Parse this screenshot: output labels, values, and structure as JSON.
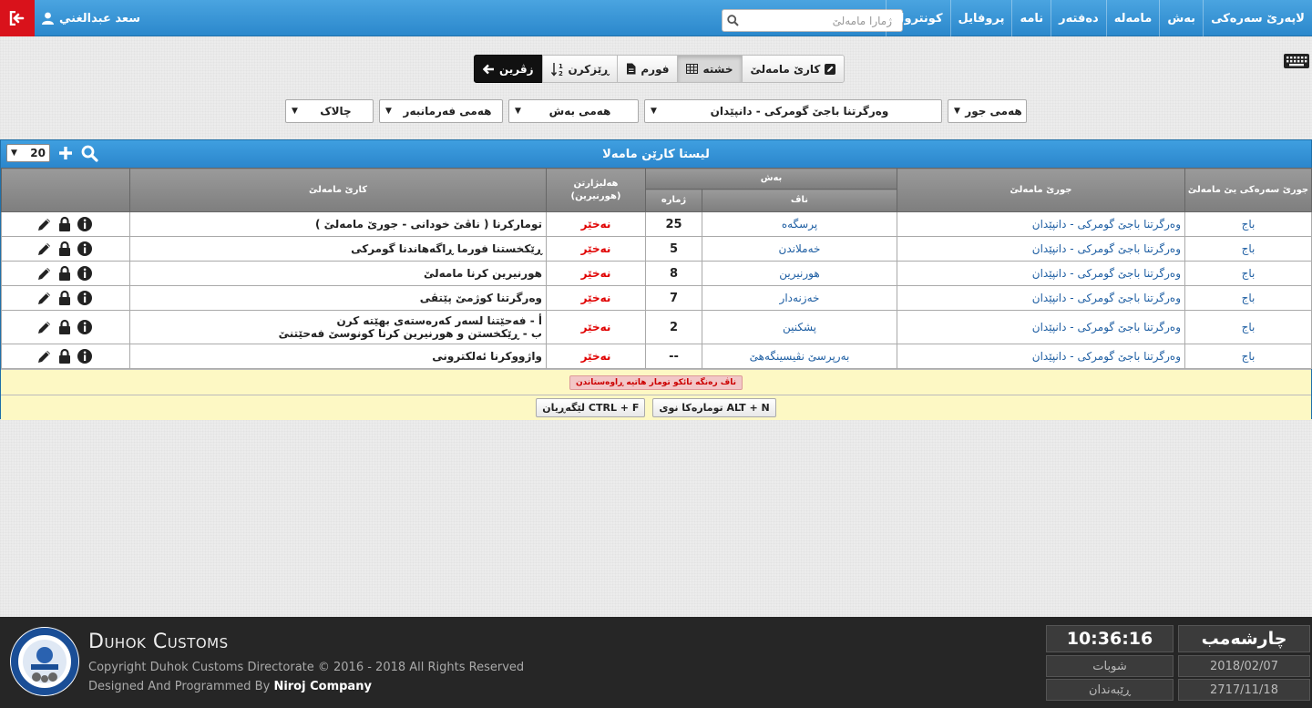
{
  "nav": {
    "items": [
      "لاپەرێ سەرەکی",
      "بەش",
      "مامەلە",
      "دەفتەر",
      "نامە",
      "پروفایل",
      "کونترول"
    ],
    "search_placeholder": "ژمارا مامەلێ",
    "user_name": "سعد عبدالغني"
  },
  "toolbar": {
    "edit_label": "کارێ مامەلێ",
    "grid_label": "خشتە",
    "form_label": "فورم",
    "sort_label": "ڕێزکرن",
    "back_label": "زڤرین"
  },
  "filters": {
    "type": "هەمی جور",
    "transaction_type": "وەرگرتنا باجێ گومرکی - دانپێدان",
    "section": "هەمی بەش",
    "officer": "هەمی فەرمانبەر",
    "status": "چالاک"
  },
  "panel": {
    "title": "لیستا کارێن مامەلا",
    "page_size": "20"
  },
  "table": {
    "headers": {
      "main_type": "جورێ سەرەکی یێ مامەلێ",
      "type": "جورێ مامەلێ",
      "section": "بەش",
      "section_name": "ناڤ",
      "section_number": "ژمارە",
      "choice": "هەلبژارتن (هورنیرین)",
      "work": "کارێ مامەلێ"
    },
    "rows": [
      {
        "main_type": "باج",
        "type": "وەرگرتنا باجێ گومرکی - دانپێدان",
        "section_name": "پرسگەه",
        "number": "25",
        "choice": "نەخێر",
        "work": "تومارکرنا ( ناڤێ خودانی - جورێ مامەلێ )"
      },
      {
        "main_type": "باج",
        "type": "وەرگرتنا باجێ گومرکی - دانپێدان",
        "section_name": "خەملاندن",
        "number": "5",
        "choice": "نەخێر",
        "work": "ڕێکخستنا فورما ڕاگەهاندنا گومرکی"
      },
      {
        "main_type": "باج",
        "type": "وەرگرتنا باجێ گومرکی - دانپێدان",
        "section_name": "هورنیرین",
        "number": "8",
        "choice": "نەخێر",
        "work": "هورنیرین کرنا مامەلێ"
      },
      {
        "main_type": "باج",
        "type": "وەرگرتنا باجێ گومرکی - دانپێدان",
        "section_name": "خەزنەدار",
        "number": "7",
        "choice": "نەخێر",
        "work": "وەرگرتنا کوژمێ پێتڤی"
      },
      {
        "main_type": "باج",
        "type": "وەرگرتنا باجێ گومرکی - دانپێدان",
        "section_name": "پشکنین",
        "number": "2",
        "choice": "نەخێر",
        "work": "أ - فەحێتنا لسەر کەرەستەی بهێتە کرن",
        "work2": "ب - ڕێکخستن و هورنیرین کرنا کونوسێ فەحێتنێ"
      },
      {
        "main_type": "باج",
        "type": "وەرگرتنا باجێ گومرکی - دانپێدان",
        "section_name": "بەرپرسێ نڤیسینگەهێ",
        "number": "--",
        "choice": "نەخێر",
        "work": "واژووکرنا ئەلکترونی"
      }
    ]
  },
  "legend": "ناڤ رەنگە نائکو تومار هاتیە ڕاوەستاندن",
  "hints": {
    "search": "CTRL + F لێگەڕیان",
    "new": "ALT + N تومارەکا نوی"
  },
  "footer": {
    "title": "Duhok Customs",
    "copyright": "Copyright Duhok Customs Directorate © 2016 - 2018 All Rights Reserved",
    "designed_prefix": "Designed And Programmed By",
    "company": "Niroj Company",
    "time": "10:36:16",
    "day": "چارشەمب",
    "hijri_month": "شوبات",
    "date": "2018/02/07",
    "kurdish_month": "ڕێبەندان",
    "kurdish_date": "2717/11/18"
  }
}
